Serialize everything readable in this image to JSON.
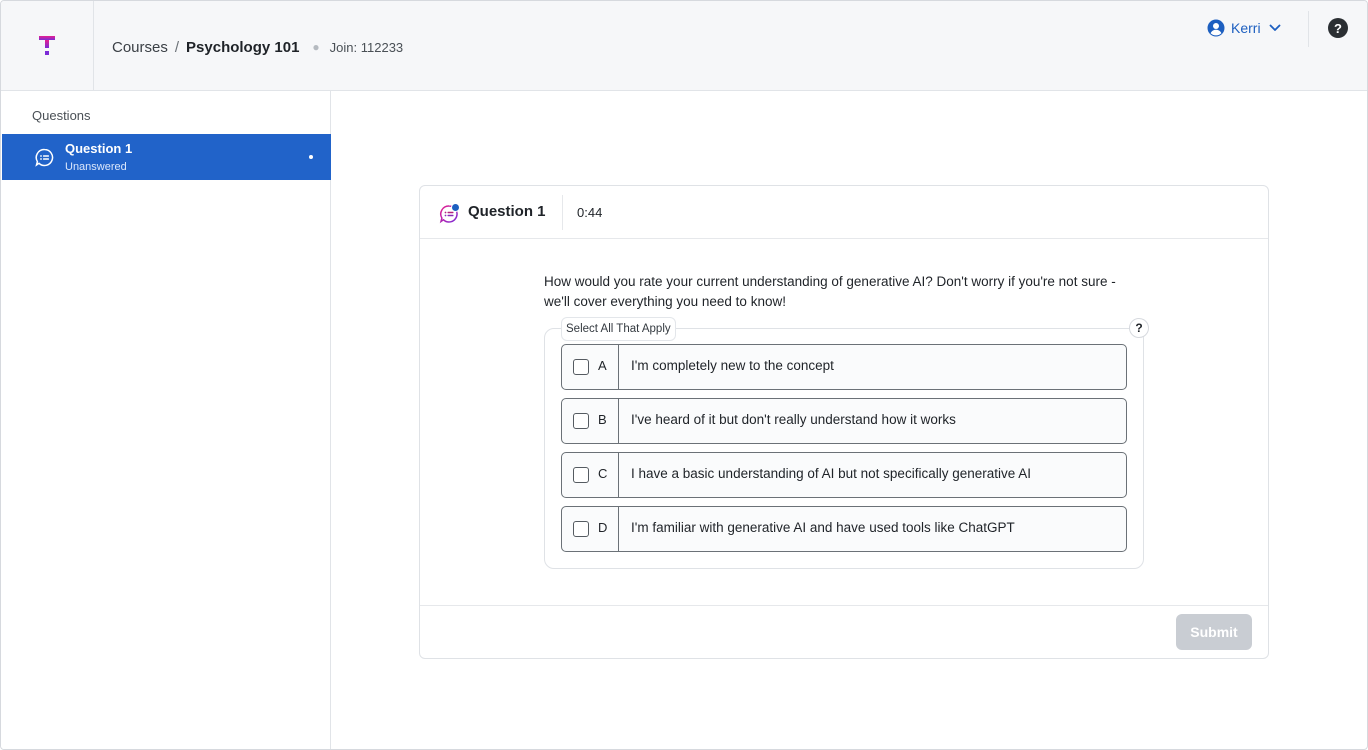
{
  "header": {
    "breadcrumb": {
      "courses": "Courses",
      "separator": "/",
      "course": "Psychology 101"
    },
    "join_label": "Join: 112233",
    "user": {
      "name": "Kerri"
    },
    "help_label": "?"
  },
  "sidebar": {
    "title": "Questions",
    "items": [
      {
        "title": "Question 1",
        "status": "Unanswered"
      }
    ]
  },
  "question": {
    "title": "Question 1",
    "timer": "0:44",
    "prompt": "How would you rate your current understanding of generative AI? Don't worry if you're not sure - we'll cover everything you need to know!",
    "instruction": "Select All That Apply",
    "hint_label": "?",
    "options": [
      {
        "letter": "A",
        "text": "I'm completely new to the concept",
        "checked": false
      },
      {
        "letter": "B",
        "text": "I've heard of it but don't really understand how it works",
        "checked": false
      },
      {
        "letter": "C",
        "text": "I have a basic understanding of AI but not specifically generative AI",
        "checked": false
      },
      {
        "letter": "D",
        "text": "I'm familiar with generative AI and have used tools like ChatGPT",
        "checked": false
      }
    ],
    "submit_label": "Submit"
  },
  "colors": {
    "accent": "#2163c9",
    "link": "#1d5fc0",
    "brand_pink": "#e6208f",
    "brand_purple": "#7b2bd6",
    "submit_disabled": "#c9cdd3"
  }
}
